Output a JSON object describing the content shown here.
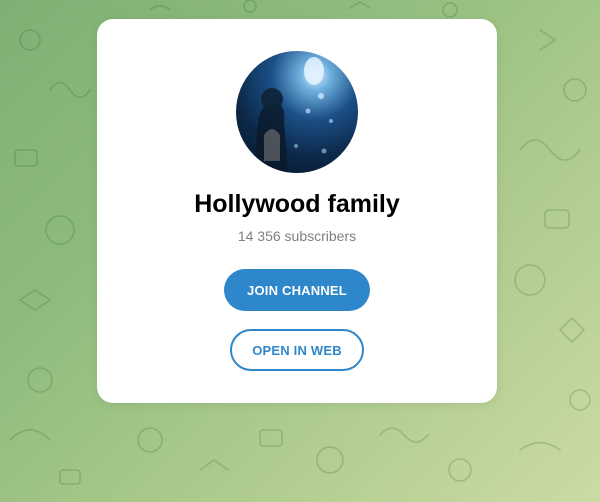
{
  "channel": {
    "name": "Hollywood family",
    "subscribers": "14 356 subscribers",
    "avatar_icon": "channel-avatar-image"
  },
  "actions": {
    "join_label": "JOIN CHANNEL",
    "open_web_label": "OPEN IN WEB"
  },
  "colors": {
    "accent": "#2e87ca",
    "card": "#ffffff",
    "subtitle": "#7d7f81"
  }
}
